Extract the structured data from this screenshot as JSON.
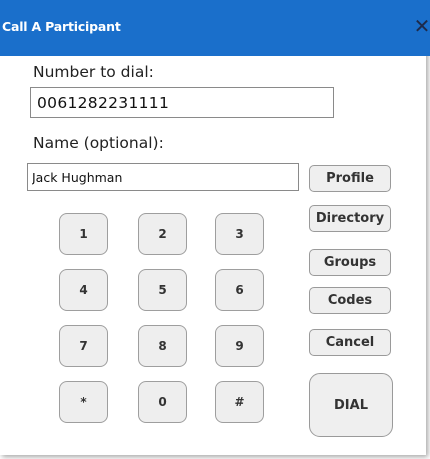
{
  "dialog": {
    "title": "Call A Participant",
    "close_glyph": "✕",
    "close_icon": "close-icon"
  },
  "form": {
    "number_label": "Number to dial:",
    "number_value": "0061282231111",
    "name_label": "Name (optional):",
    "name_value": "Jack Hughman"
  },
  "keypad": {
    "keys": [
      "1",
      "2",
      "3",
      "4",
      "5",
      "6",
      "7",
      "8",
      "9",
      "*",
      "0",
      "#"
    ]
  },
  "buttons": {
    "profile": "Profile",
    "directory": "Directory",
    "groups": "Groups",
    "codes": "Codes",
    "cancel": "Cancel",
    "dial": "DIAL"
  },
  "colors": {
    "titlebar": "#1a6fcb",
    "button_bg": "#eeeeee",
    "border": "#9e9e9e"
  }
}
